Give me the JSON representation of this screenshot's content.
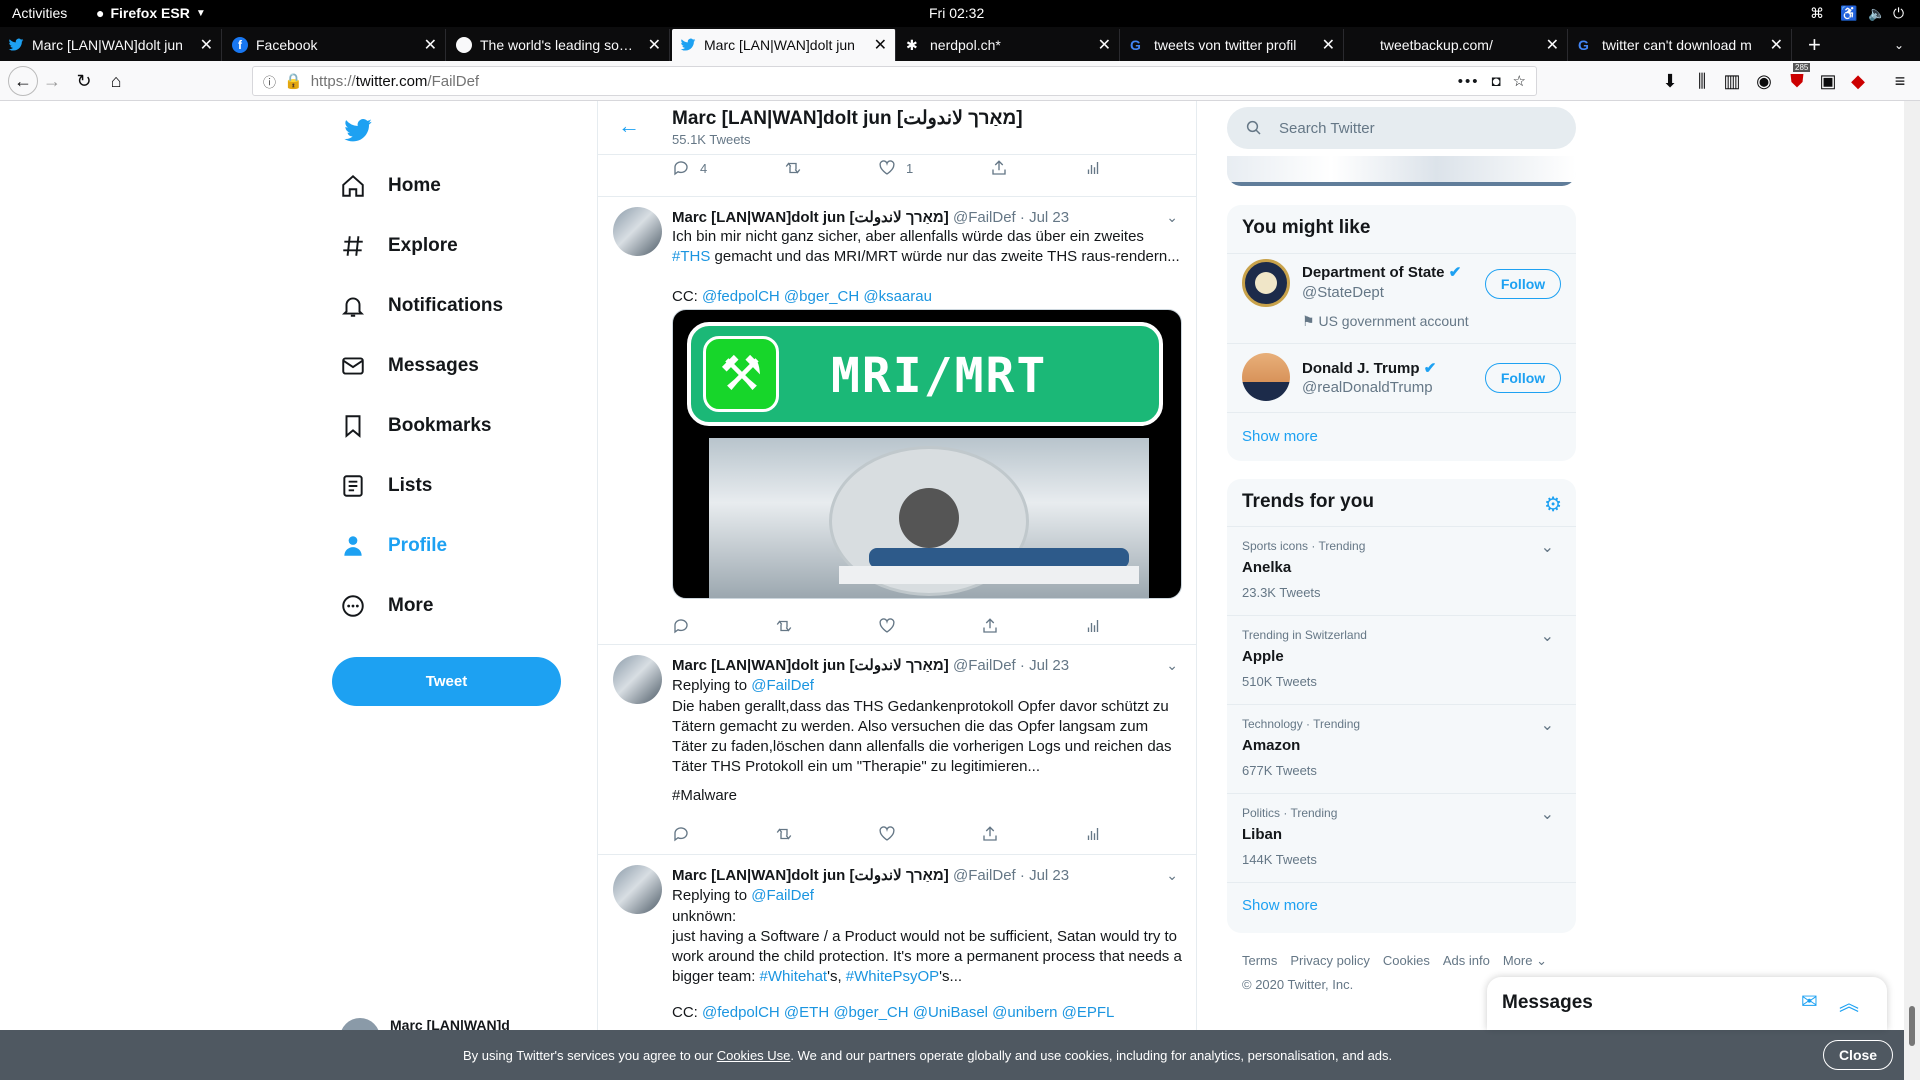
{
  "system": {
    "activities": "Activities",
    "app_menu": "Firefox ESR",
    "clock": "Fri 02:32"
  },
  "tabs": [
    {
      "title": "Marc [LAN|WAN]dolt jun",
      "icon": "twitter-icon",
      "active": false
    },
    {
      "title": "Facebook",
      "icon": "facebook-icon",
      "active": false
    },
    {
      "title": "The world's leading softw",
      "icon": "github-icon",
      "active": false
    },
    {
      "title": "Marc [LAN|WAN]dolt jun",
      "icon": "twitter-icon",
      "active": true
    },
    {
      "title": "nerdpol.ch*",
      "icon": "diaspora-icon",
      "active": false
    },
    {
      "title": "tweets von twitter profil",
      "icon": "google-icon",
      "active": false
    },
    {
      "title": "tweetbackup.com/",
      "icon": "",
      "active": false
    },
    {
      "title": "twitter can't download m",
      "icon": "google-icon",
      "active": false
    }
  ],
  "browser": {
    "url_scheme": "https://",
    "url_host": "twitter.com",
    "url_path": "/FailDef",
    "badge_count": "285"
  },
  "sidebar": {
    "items": [
      {
        "label": "Home",
        "icon": "home-icon"
      },
      {
        "label": "Explore",
        "icon": "hashtag-icon"
      },
      {
        "label": "Notifications",
        "icon": "bell-icon"
      },
      {
        "label": "Messages",
        "icon": "envelope-icon"
      },
      {
        "label": "Bookmarks",
        "icon": "bookmark-icon"
      },
      {
        "label": "Lists",
        "icon": "list-icon"
      },
      {
        "label": "Profile",
        "icon": "person-icon"
      },
      {
        "label": "More",
        "icon": "more-icon"
      }
    ],
    "tweet_button": "Tweet",
    "account_name_partial": "Marc [LAN|WAN]d"
  },
  "header": {
    "name": "Marc [LAN|WAN]dolt jun [מאַרך لاندولت]",
    "tweet_count": "55.1K Tweets"
  },
  "top_actions": {
    "replies": "4",
    "likes": "1"
  },
  "tweets": [
    {
      "name": "Marc [LAN|WAN]dolt jun [מאַרך لاندولت]",
      "handle": "@FailDef",
      "date": "Jul 23",
      "line1": "Ich bin mir nicht ganz sicher, aber allenfalls würde das über ein zweites",
      "hashtag": "#THS",
      "line2": " gemacht und das MRI/MRT würde nur das zweite THS raus-rendern...",
      "cc_label": "CC: ",
      "mentions": "@fedpolCH @bger_CH @ksaarau",
      "image_title": "MRI/MRT"
    },
    {
      "name": "Marc [LAN|WAN]dolt jun [מאַרך لاندولت]",
      "handle": "@FailDef",
      "date": "Jul 23",
      "replying_label": "Replying to ",
      "replying_to": "@FailDef",
      "text": "Die haben gerallt,dass das THS Gedankenprotokoll Opfer davor schützt zu Tätern gemacht zu werden. Also versuchen die das Opfer langsam zum Täter zu faden,löschen dann allenfalls die vorherigen Logs und reichen das Täter THS Protokoll ein um \"Therapie\" zu legitimieren...",
      "hashtag": "#Malware"
    },
    {
      "name": "Marc [LAN|WAN]dolt jun [מאַרך لاندولت]",
      "handle": "@FailDef",
      "date": "Jul 23",
      "replying_label": "Replying to ",
      "replying_to": "@FailDef",
      "line1": "unknöwn:",
      "line2": "just having a Software / a Product would not be sufficient, Satan would try to work around the child protection. It's more a permanent process that needs a bigger team: ",
      "tag1": "#Whitehat",
      "mid": "'s, ",
      "tag2": "#WhitePsyOP",
      "end": "'s...",
      "cc_label": "CC: ",
      "mentions": "@fedpolCH @ETH @bger_CH @UniBasel @unibern @EPFL"
    }
  ],
  "search": {
    "placeholder": "Search Twitter"
  },
  "you_might_like": {
    "title": "You might like",
    "accounts": [
      {
        "name": "Department of State",
        "handle": "@StateDept",
        "note": "US government account",
        "button": "Follow"
      },
      {
        "name": "Donald J. Trump",
        "handle": "@realDonaldTrump",
        "button": "Follow"
      }
    ],
    "show_more": "Show more"
  },
  "trends": {
    "title": "Trends for you",
    "items": [
      {
        "context": "Sports icons · Trending",
        "name": "Anelka",
        "count": "23.3K Tweets"
      },
      {
        "context": "Trending in Switzerland",
        "name": "Apple",
        "count": "510K Tweets"
      },
      {
        "context": "Technology · Trending",
        "name": "Amazon",
        "count": "677K Tweets"
      },
      {
        "context": "Politics · Trending",
        "name": "Liban",
        "count": "144K Tweets"
      }
    ],
    "show_more": "Show more"
  },
  "footer": {
    "terms": "Terms",
    "privacy": "Privacy policy",
    "cookies": "Cookies",
    "ads": "Ads info",
    "more": "More",
    "copyright": "© 2020 Twitter, Inc."
  },
  "messages_drawer": {
    "title": "Messages"
  },
  "cookie_banner": {
    "prefix": "By using Twitter's services you agree to our ",
    "link": "Cookies Use",
    "suffix": ". We and our partners operate globally and use cookies, including for analytics, personalisation, and ads.",
    "close": "Close"
  },
  "colors": {
    "accent": "#1da1f2",
    "link": "#1b95e0",
    "text": "#14171a",
    "secondary": "#657786"
  }
}
